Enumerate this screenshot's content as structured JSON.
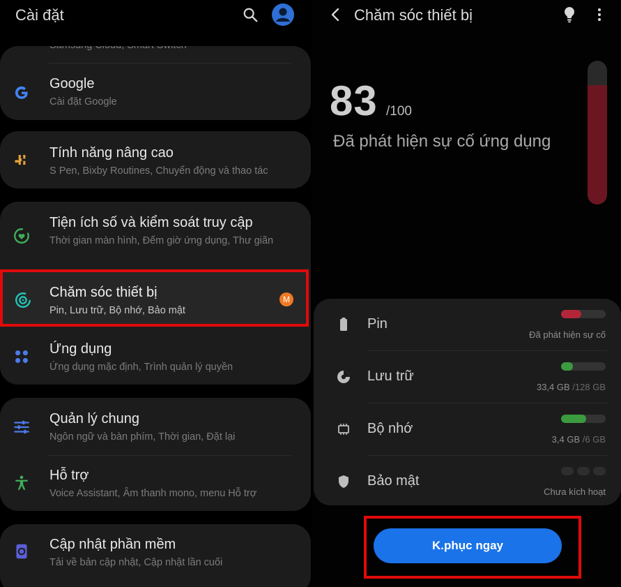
{
  "left": {
    "header": {
      "title": "Cài đặt",
      "search_icon": "search-icon",
      "avatar_icon": "account-avatar-icon"
    },
    "items": [
      {
        "title": "",
        "subtitle": "Samsung Cloud, Smart Switch",
        "icon": ""
      },
      {
        "title": "Google",
        "subtitle": "Cài đặt Google",
        "icon": "google-icon",
        "color": "#4285f4"
      },
      {
        "title": "Tính năng nâng cao",
        "subtitle": "S Pen, Bixby Routines, Chuyển động và thao tác",
        "icon": "puzzle-icon",
        "color": "#e8a23b"
      },
      {
        "title": "Tiện ích số và kiểm soát truy cập",
        "subtitle": "Thời gian màn hình, Đếm giờ ứng dụng, Thư giãn",
        "icon": "digital-wellbeing-icon",
        "color": "#3fae5a"
      },
      {
        "title": "Chăm sóc thiết bị",
        "subtitle": "Pin, Lưu trữ, Bộ nhớ, Bảo mật",
        "icon": "device-care-icon",
        "color": "#22c5b8",
        "badge": "M"
      },
      {
        "title": "Ứng dụng",
        "subtitle": "Ứng dụng mặc định, Trình quản lý quyền",
        "icon": "apps-icon",
        "color": "#4c7be8"
      },
      {
        "title": "Quản lý chung",
        "subtitle": "Ngôn ngữ và bàn phím, Thời gian, Đặt lại",
        "icon": "sliders-icon",
        "color": "#4c7be8"
      },
      {
        "title": "Hỗ trợ",
        "subtitle": "Voice Assistant, Âm thanh mono, menu Hỗ trợ",
        "icon": "accessibility-icon",
        "color": "#3fae5a"
      },
      {
        "title": "Cập nhật phần mềm",
        "subtitle": "Tải về bản cập nhật, Cập nhật lần cuối",
        "icon": "software-update-icon",
        "color": "#5b5fd6"
      }
    ]
  },
  "right": {
    "header": {
      "title": "Chăm sóc thiết bị",
      "back_icon": "back-arrow-icon",
      "bulb_icon": "lightbulb-icon",
      "more_icon": "more-vertical-icon"
    },
    "score": "83",
    "score_max": "/100",
    "status": "Đã phát hiện sự cố ứng dụng",
    "gauge_level": 0.83,
    "items": [
      {
        "label": "Pin",
        "icon": "battery-icon",
        "value": "Đã phát hiện sự cố",
        "total": "",
        "level": 0.45,
        "bar_color": "#b3263a"
      },
      {
        "label": "Lưu trữ",
        "icon": "storage-icon",
        "value": "33,4 GB",
        "total": "/128 GB",
        "level": 0.27,
        "bar_color": "#3b9b3f"
      },
      {
        "label": "Bộ nhớ",
        "icon": "memory-icon",
        "value": "3,4 GB",
        "total": "/6 GB",
        "level": 0.57,
        "bar_color": "#3b9b3f"
      },
      {
        "label": "Bảo mật",
        "icon": "shield-icon",
        "value": "Chưa kích hoạt",
        "total": "",
        "level": null,
        "bar_color": ""
      }
    ],
    "action_button": "K.phục ngay",
    "colors": {
      "accent": "#1a73e8",
      "highlight": "#e10a0a",
      "badge": "#f07a24"
    }
  }
}
